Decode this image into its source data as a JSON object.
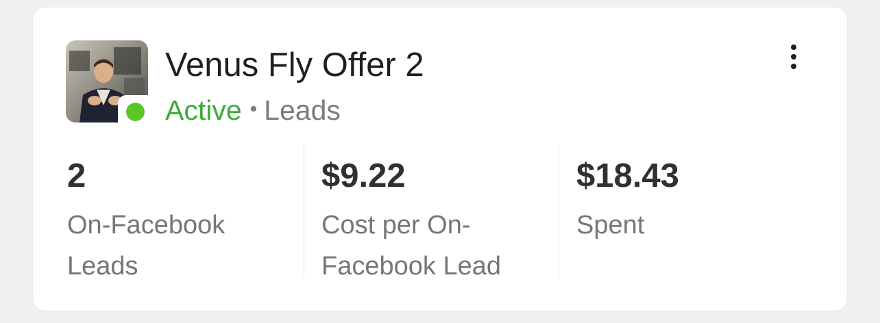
{
  "campaign": {
    "title": "Venus Fly Offer 2",
    "status": "Active",
    "separator": "•",
    "objective": "Leads"
  },
  "stats": [
    {
      "value": "2",
      "label_line1": "On-Facebook",
      "label_line2": "Leads"
    },
    {
      "value": "$9.22",
      "label_line1": "Cost per On-",
      "label_line2": "Facebook Lead"
    },
    {
      "value": "$18.43",
      "label_line1": "Spent",
      "label_line2": ""
    }
  ],
  "icons": {
    "more": "more-vertical-icon",
    "status": "status-active-dot"
  },
  "colors": {
    "active": "#3cac3a",
    "status_dot": "#5ac725",
    "muted": "#767676"
  }
}
